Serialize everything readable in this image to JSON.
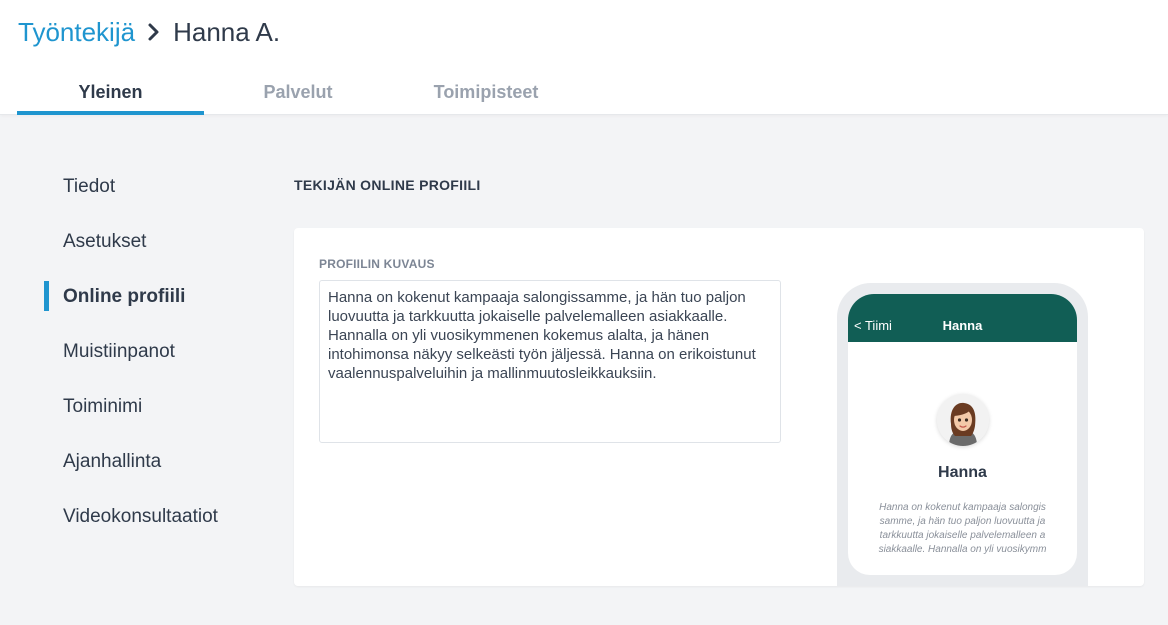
{
  "breadcrumb": {
    "parent": "Työntekijä",
    "separator_icon": "chevron-right-icon",
    "current": "Hanna A."
  },
  "tabs": [
    {
      "label": "Yleinen",
      "active": true
    },
    {
      "label": "Palvelut",
      "active": false
    },
    {
      "label": "Toimipisteet",
      "active": false
    }
  ],
  "sidebar": {
    "items": [
      {
        "label": "Tiedot",
        "active": false
      },
      {
        "label": "Asetukset",
        "active": false
      },
      {
        "label": "Online profiili",
        "active": true
      },
      {
        "label": "Muistiinpanot",
        "active": false
      },
      {
        "label": "Toiminimi",
        "active": false
      },
      {
        "label": "Ajanhallinta",
        "active": false
      },
      {
        "label": "Videokonsultaatiot",
        "active": false
      }
    ]
  },
  "main": {
    "section_title": "TEKIJÄN ONLINE PROFIILI",
    "description_label": "PROFIILIN KUVAUS",
    "description_value": "Hanna on kokenut kampaaja salongissamme, ja hän tuo paljon luovuutta ja tarkkuutta jokaiselle palvelemalleen asiakkaalle. Hannalla on yli vuosikymmenen kokemus alalta, ja hänen intohimonsa näkyy selkeästi työn jäljessä. Hanna on erikoistunut vaalennuspalveluihin ja mallinmuutosleikkauksiin."
  },
  "preview": {
    "back_label": "< Tiimi",
    "header_title": "Hanna",
    "name": "Hanna",
    "description": "Hanna on kokenut kampaaja salongis samme, ja hän tuo paljon luovuutta ja tarkkuutta jokaiselle palvelemalleen a siakkaalle. Hannalla on yli vuosikymm"
  },
  "colors": {
    "accent": "#1f95cf",
    "phone_header": "#115e55",
    "background": "#f3f4f6"
  }
}
